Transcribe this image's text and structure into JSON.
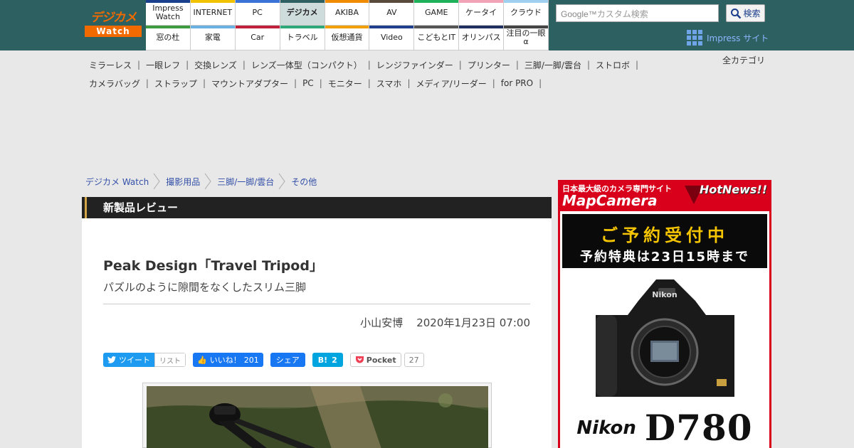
{
  "header": {
    "logo_top": "デジカメ",
    "logo_bottom": "Watch",
    "nav_top": [
      {
        "label": "Impress Watch",
        "color": "#1a3f8c"
      },
      {
        "label": "INTERNET",
        "color": "#f2c200"
      },
      {
        "label": "PC",
        "color": "#3a72d8"
      },
      {
        "label": "デジカメ",
        "color": "#2d6060"
      },
      {
        "label": "AKIBA",
        "color": "#f08a00"
      },
      {
        "label": "AV",
        "color": "#5a4a3c"
      },
      {
        "label": "GAME",
        "color": "#1fb05a"
      },
      {
        "label": "ケータイ",
        "color": "#f2a3b6"
      },
      {
        "label": "クラウド",
        "color": "#9fd0f0"
      }
    ],
    "nav_bottom": [
      {
        "label": "窓の杜",
        "color": "#3f9b3f"
      },
      {
        "label": "家電",
        "color": "#6ab0e0"
      },
      {
        "label": "Car",
        "color": "#c0203a"
      },
      {
        "label": "トラベル",
        "color": "#2fa87a"
      },
      {
        "label": "仮想通貨",
        "color": "#f0a000"
      },
      {
        "label": "Video",
        "color": "#1f3f8c"
      },
      {
        "label": "こどもとIT",
        "color": "#555555"
      },
      {
        "label": "オリンパス",
        "color": "#1e2e5e"
      },
      {
        "label": "注目の一眼α",
        "color": "#444444"
      }
    ],
    "search_placeholder": "カスタム検索",
    "search_brand": "Google™",
    "search_button": "検索",
    "impress_sites": "Impress サイト"
  },
  "categories": {
    "row1": [
      "ミラーレス",
      "一眼レフ",
      "交換レンズ",
      "レンズ一体型（コンパクト）",
      "レンジファインダー",
      "プリンター",
      "三脚/一脚/雲台",
      "ストロボ"
    ],
    "row2": [
      "カメラバッグ",
      "ストラップ",
      "マウントアダプター",
      "PC",
      "モニター",
      "スマホ",
      "メディア/リーダー",
      "for PRO"
    ],
    "all": "全カテゴリ"
  },
  "breadcrumb": [
    "デジカメ Watch",
    "撮影用品",
    "三脚/一脚/雲台",
    "その他"
  ],
  "article": {
    "kicker": "新製品レビュー",
    "title": "Peak Design「Travel Tripod」",
    "subtitle": "パズルのように隙間をなくしたスリム三脚",
    "author": "小山安博",
    "date": "2020年1月23日 07:00"
  },
  "social": {
    "tweet": "ツイート",
    "list": "リスト",
    "like": "いいね！",
    "like_count": "201",
    "share": "シェア",
    "hatena": "B!",
    "hatena_count": "2",
    "pocket": "Pocket",
    "pocket_count": "27"
  },
  "ad": {
    "sub": "日本最大級のカメラ専門サイト",
    "brand": "MapCamera",
    "hot": "HotNews!!",
    "line1": "ご予約受付中",
    "line2": "予約特典は23日15時まで",
    "maker": "Nikon",
    "model": "D780",
    "camera_badge": "Nikon"
  }
}
